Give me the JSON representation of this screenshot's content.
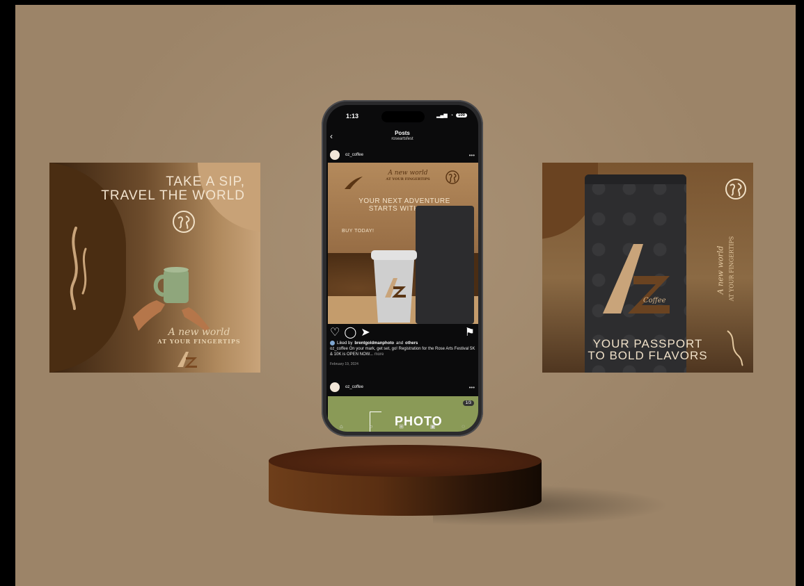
{
  "left_poster": {
    "title_line1": "TAKE A SIP,",
    "title_line2": "TRAVEL THE WORLD",
    "script": "A new world",
    "tagline": "AT YOUR FINGERTIPS",
    "logo": "AZ"
  },
  "right_poster": {
    "brand": "Coffee",
    "side_script": "A new world",
    "side_tag": "AT YOUR FINGERTIPS",
    "title_line1": "YOUR PASSPORT",
    "title_line2": "TO BOLD FLAVORS"
  },
  "phone": {
    "status": {
      "time": "1:13",
      "battery": "100"
    },
    "nav": {
      "back_icon": "chevron-left-icon",
      "title": "Posts",
      "subtitle": "roseartsfest"
    },
    "post": {
      "handle": "oz_coffee",
      "image": {
        "script": "A new world",
        "tagline": "AT YOUR FINGERTIPS",
        "headline_line1": "YOUR NEXT ADVENTURE",
        "headline_line2": "STARTS WITH A SIP",
        "cta": "BUY TODAY!"
      },
      "liked_prefix": "Liked by",
      "liked_user": "brentgoldmanphoto",
      "liked_and": "and",
      "liked_others": "others",
      "caption_user": "oz_coffee",
      "caption_text": "On your mark, get set, go! Registration for the Rose Arts Festival 5K & 10K is OPEN NOW...",
      "caption_more": "more",
      "date": "February 19, 2024"
    },
    "post2": {
      "handle": "oz_coffee",
      "count": "1/3",
      "image_text": "PHOTO"
    }
  },
  "colors": {
    "backdrop": "#9c8468",
    "pedestal": "#4a220e",
    "poster_text": "#f3e4cf"
  }
}
